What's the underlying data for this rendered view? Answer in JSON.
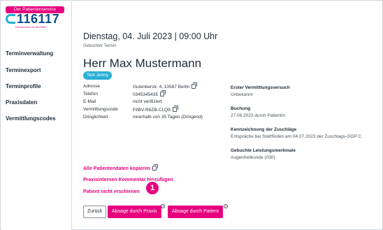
{
  "logo": {
    "top_text": "Der Patientenservice",
    "number": "116117",
    "tagline": "Die Nummer mit den Elfen"
  },
  "sidebar": {
    "items": [
      {
        "label": "Terminverwaltung"
      },
      {
        "label": "Terminexport"
      },
      {
        "label": "Terminprofile"
      },
      {
        "label": "Praxisdaten"
      },
      {
        "label": "Vermittlungscodes"
      }
    ]
  },
  "appointment": {
    "title": "Dienstag, 04. Juli 2023 | 09:00 Uhr",
    "subtitle": "Gebuchter Termin"
  },
  "patient": {
    "name": "Herr Max Mustermann",
    "tag": "Test Jenny",
    "fields": [
      {
        "label": "Adresse",
        "value": "Gutenberstr. 4, 10587 Berlin",
        "copy": true
      },
      {
        "label": "Telefon",
        "value": "0345345435",
        "copy": true
      },
      {
        "label": "E-Mail",
        "value": "nicht verifiziert",
        "copy": false
      },
      {
        "label": "Vermittlungscode",
        "value": "F8BV-R6ZB-CLQ9",
        "copy": true
      },
      {
        "label": "Dringlichkeit",
        "value": "innerhalb von 35 Tagen (Dringend)",
        "copy": false
      }
    ]
  },
  "details": {
    "erster_versuch_heading": "Erster Vermittlungsversuch",
    "erster_versuch_value": "Unbekannt",
    "buchung_heading": "Buchung",
    "buchung_value": "27.06.2023 durch PatientIn",
    "kennzeichnung_heading": "Kennzeichnung der Zuschläge",
    "kennzeichnung_value": "Entspräche bei Stattfinden am 04.07.2023 der Zuschlags-GOP C",
    "leistung_heading": "Gebuchte Leistungsmerkmale",
    "leistung_value": "Augenheilkunde (030)"
  },
  "actions": {
    "copy_all": "Alle Patientendaten kopieren",
    "add_comment": "Praxisinternen Kommentar hinzufügen",
    "no_show": "Patient nicht erschienen",
    "back": "Zurück",
    "cancel_practice": "Absage durch Praxis",
    "cancel_patient": "Absage durch Patient",
    "help_glyph": "?"
  },
  "marker": {
    "label": "1"
  },
  "colors": {
    "accent_pink": "#e6007e",
    "tag_blue": "#2ab0d6",
    "logo_blue": "#0b4a8c"
  }
}
